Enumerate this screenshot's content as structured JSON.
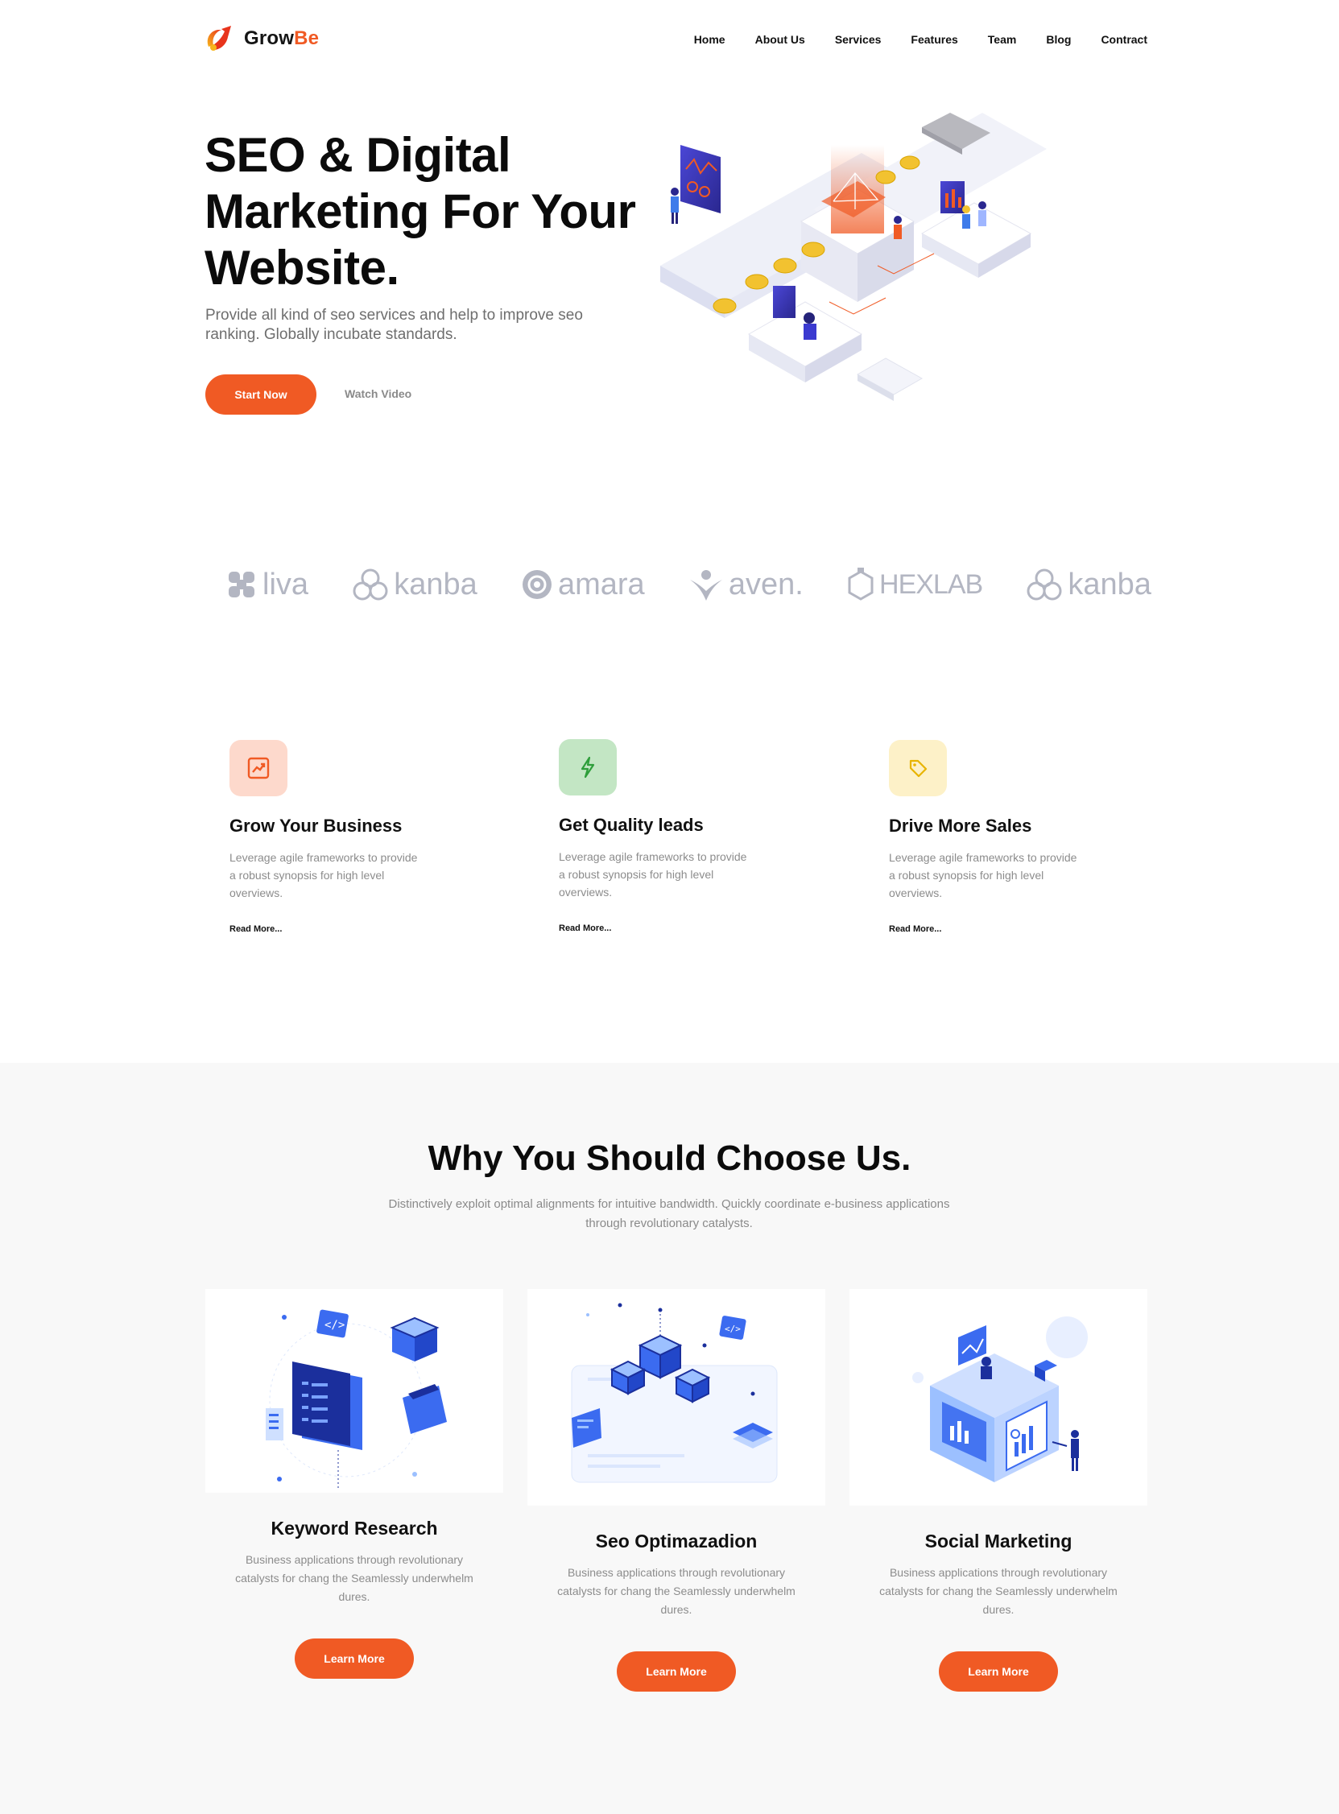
{
  "brand": {
    "name_main": "Grow",
    "name_accent": "Be",
    "accent_color": "#f05a24"
  },
  "nav": {
    "items": [
      "Home",
      "About Us",
      "Services",
      "Features",
      "Team",
      "Blog",
      "Contract"
    ]
  },
  "hero": {
    "title": "SEO & Digital Marketing For Your Website.",
    "subtitle": "Provide all kind of seo services and help to improve seo ranking. Globally incubate standards.",
    "primary_button": "Start Now",
    "secondary_link": "Watch Video"
  },
  "partners": [
    "liva",
    "kanba",
    "amara",
    "aven.",
    "HEXLAB",
    "kanba"
  ],
  "features": [
    {
      "title": "Grow Your Business",
      "text": "Leverage agile frameworks to provide a robust synopsis for high level overviews.",
      "link": "Read More...",
      "icon": "trend-up-icon",
      "icon_bg": "#fdd9cc",
      "icon_color": "#f05a24"
    },
    {
      "title": "Get Quality leads",
      "text": "Leverage agile frameworks to provide a robust synopsis for high level overviews.",
      "link": "Read More...",
      "icon": "lightning-icon",
      "icon_bg": "#c3e6c4",
      "icon_color": "#2e9e3a"
    },
    {
      "title": "Drive More Sales",
      "text": "Leverage agile frameworks to provide a robust synopsis for high level overviews.",
      "link": "Read More...",
      "icon": "tag-icon",
      "icon_bg": "#fdf1c8",
      "icon_color": "#e8b400"
    }
  ],
  "why": {
    "title": "Why You Should Choose Us.",
    "subtitle": "Distinctively exploit optimal alignments for intuitive bandwidth. Quickly coordinate e-business applications through revolutionary catalysts.",
    "cards": [
      {
        "title": "Keyword Research",
        "text": "Business applications through revolutionary catalysts for chang the Seamlessly underwhelm dures.",
        "button": "Learn More"
      },
      {
        "title": "Seo Optimazadion",
        "text": "Business applications through revolutionary catalysts for chang the Seamlessly underwhelm dures.",
        "button": "Learn More"
      },
      {
        "title": "Social Marketing",
        "text": "Business applications through revolutionary catalysts for chang the Seamlessly underwhelm dures.",
        "button": "Learn More"
      }
    ]
  }
}
